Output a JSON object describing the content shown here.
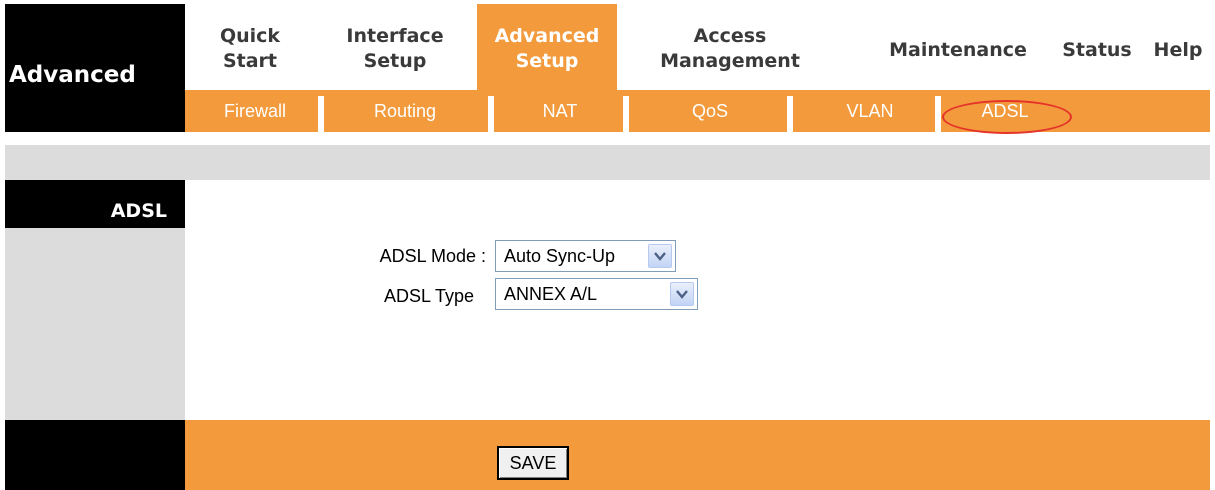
{
  "section_label": "Advanced",
  "nav": {
    "quick_start": "Quick\nStart",
    "interface_setup": "Interface\nSetup",
    "advanced_setup": "Advanced\nSetup",
    "access_management": "Access\nManagement",
    "maintenance": "Maintenance",
    "status": "Status",
    "help": "Help"
  },
  "subnav": {
    "firewall": "Firewall",
    "routing": "Routing",
    "nat": "NAT",
    "qos": "QoS",
    "vlan": "VLAN",
    "adsl": "ADSL"
  },
  "sidebar": {
    "title": "ADSL"
  },
  "form": {
    "adsl_mode_label": "ADSL Mode :",
    "adsl_mode_value": "Auto Sync-Up",
    "adsl_type_label": "ADSL Type",
    "adsl_type_value": "ANNEX A/L"
  },
  "footer": {
    "save_label": "SAVE"
  },
  "colors": {
    "accent": "#f29a3c",
    "highlight_oval": "#e5332a"
  },
  "icons": {
    "dropdown": "chevron-down-icon"
  }
}
